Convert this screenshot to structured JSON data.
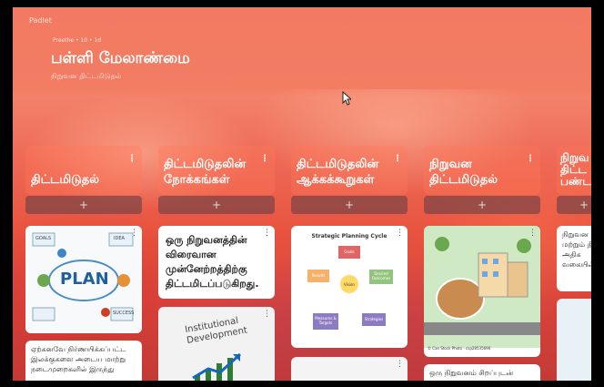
{
  "app": {
    "brand": "Padlet"
  },
  "header": {
    "meta": "Preethe • 10 • 1d",
    "title": "பள்ளி மேலாண்மை",
    "subtitle": "நிறுவன திட்டமிடுதல்"
  },
  "columns": [
    {
      "title": "திட்டமிடுதல்",
      "add_label": "+"
    },
    {
      "title": "திட்டமிடுதலின் நோக்கங்கள்",
      "add_label": "+"
    },
    {
      "title": "திட்டமிடுதலின் ஆக்கக்கூறுகள்",
      "add_label": "+"
    },
    {
      "title": "நிறுவன திட்டமிடுதல்",
      "add_label": "+"
    },
    {
      "title": "நிறுவ திட்ட பண்ட",
      "add_label": "+"
    }
  ],
  "cards": {
    "plan_image": {
      "words": [
        "PLAN",
        "GOALS",
        "IDEA",
        "SUCCESS"
      ]
    },
    "plan_caption": "ஏற்கனவே நிர்ணயிக்கப்பட்ட இலக்குகளை அடைய மாற்று நடைமுறைகளில் இருந்து",
    "objective_text": "ஒரு நிறுவனத்தின் விரைவான முன்னேற்றத்திற்கு திட்டமிடப்படுகிறது.",
    "inst_dev": "Institutional Development",
    "cycle": {
      "title": "Strategic Planning Cycle",
      "nodes": [
        "Goals",
        "Results",
        "Vision",
        "Desired Outcomes",
        "Measures & Targets",
        "Strategies"
      ]
    },
    "school_caption": "© Can Stock Photo - csp28535696",
    "school_text": "ஒரு நிறுவனம் சிறப்புடன்",
    "partial_text": "நிறுவன மற்றும் திட்ட அதிக வகையில்"
  },
  "colors": {
    "accent": "#f27a62"
  }
}
